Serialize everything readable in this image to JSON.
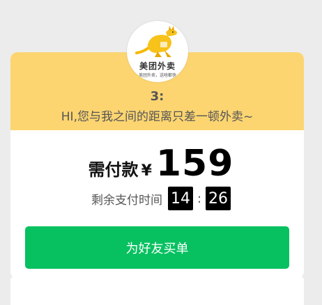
{
  "brand": {
    "name": "美团外卖",
    "tagline": "美团外卖，送啥都快",
    "icon": "kangaroo-logo"
  },
  "greeting": {
    "number": "3:",
    "message": "HI,您与我之间的距离只差一顿外卖~"
  },
  "payment": {
    "label": "需付款",
    "currency": "¥",
    "amount": "159"
  },
  "timer": {
    "label": "剩余支付时间",
    "minutes": "14",
    "separator": ":",
    "seconds": "26"
  },
  "action": {
    "button_label": "为好友买单"
  },
  "colors": {
    "header": "#fcd571",
    "button": "#07c160",
    "background": "#ececec"
  }
}
